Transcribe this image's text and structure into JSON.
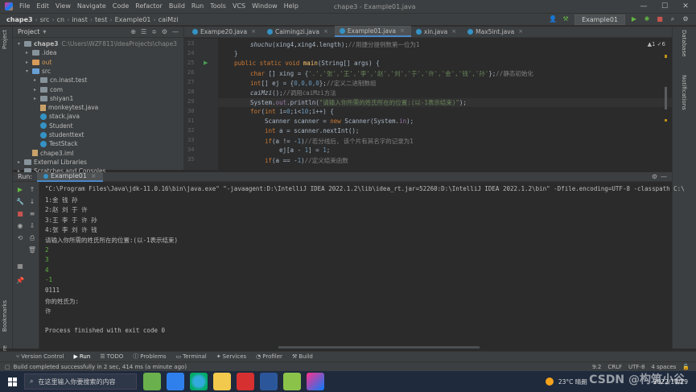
{
  "title_bar": {
    "menus": [
      "File",
      "Edit",
      "View",
      "Navigate",
      "Code",
      "Refactor",
      "Build",
      "Run",
      "Tools",
      "VCS",
      "Window",
      "Help"
    ],
    "window_title": "chape3 - Example01.java",
    "controls": [
      "—",
      "☐",
      "✕"
    ]
  },
  "nav_bar": {
    "crumbs": [
      "chape3",
      "src",
      "cn",
      "inast",
      "test",
      "Example01",
      "caiMzi"
    ],
    "run_config": "Example01"
  },
  "project_panel": {
    "title": "Project",
    "rows": [
      {
        "label": "chape3",
        "extra": "C:\\Users\\WZF811\\IdeaProjects\\chape3",
        "level": 0,
        "icon": "folder",
        "open": true
      },
      {
        "label": ".idea",
        "level": 1,
        "icon": "folder",
        "open": false
      },
      {
        "label": "out",
        "level": 1,
        "icon": "folder-orange",
        "open": false
      },
      {
        "label": "src",
        "level": 1,
        "icon": "folder-blue",
        "open": true
      },
      {
        "label": "cn.inast.test",
        "level": 2,
        "icon": "package",
        "open": false
      },
      {
        "label": "com",
        "level": 2,
        "icon": "package",
        "open": false
      },
      {
        "label": "shiyan1",
        "level": 2,
        "icon": "package",
        "open": false
      },
      {
        "label": "monkeytest.java",
        "level": 2,
        "icon": "file"
      },
      {
        "label": "stack.java",
        "level": 2,
        "icon": "class"
      },
      {
        "label": "Student",
        "level": 2,
        "icon": "class"
      },
      {
        "label": "studenttext",
        "level": 2,
        "icon": "class"
      },
      {
        "label": "TestStack",
        "level": 2,
        "icon": "class"
      },
      {
        "label": "chape3.iml",
        "level": 1,
        "icon": "file"
      },
      {
        "label": "External Libraries",
        "level": 0,
        "icon": "folder",
        "open": false
      },
      {
        "label": "Scratches and Consoles",
        "level": 0,
        "icon": "folder",
        "open": false
      }
    ]
  },
  "editor": {
    "tabs": [
      {
        "label": "Exampe20.java",
        "active": false
      },
      {
        "label": "Caimingzi.java",
        "active": false
      },
      {
        "label": "Example01.java",
        "active": true
      },
      {
        "label": "xin.java",
        "active": false
      },
      {
        "label": "Max5int.java",
        "active": false
      }
    ],
    "inspection": "▲1 ✓6",
    "line_numbers": [
      "23",
      "24",
      "25",
      "26",
      "27",
      "28",
      "29",
      "30",
      "31",
      "32",
      "33",
      "34",
      "35"
    ],
    "code": {
      "l23a": "shuchu",
      "l23b": "(xing4,xing4.length);",
      "l23c": "//用捷分提例数第一位为1",
      "l24": "}",
      "l25a": "public static void ",
      "l25b": "main",
      "l25c": "(String[] args) {",
      "l26a": "char",
      "l26b": " [] xing = {",
      "l26c": "'.','张','王','李','赵','刘','于','许','金','钱','孙'",
      "l26d": "};",
      "l26e": "//静态初始化",
      "l27a": "int",
      "l27b": "[] ej = {",
      "l27c": "0,0,0,0",
      "l27d": "};",
      "l27e": "//定义二进制数组",
      "l28a": "caiMzi",
      "l28b": "();",
      "l28c": "//调用caiMzi方法",
      "l29a": "System.",
      "l29b": "out",
      "l29c": ".println(",
      "l29d": "\"请输入你所需的姓氏所在的位置:(以-1表示结束)\"",
      "l29e": ");",
      "l30a": "for",
      "l30b": "(",
      "l30c": "int",
      "l30d": " i=",
      "l30e": "0",
      "l30f": ";i<",
      "l30g": "10",
      "l30h": ";i++) {",
      "l31a": "Scanner scanner = ",
      "l31b": "new",
      "l31c": " Scanner(System.",
      "l31d": "in",
      "l31e": ");",
      "l32a": "int",
      "l32b": " a = scanner.nextInt();",
      "l33a": "if",
      "l33b": "(a != -",
      "l33c": "1",
      "l33d": ")",
      "l33e": "//若分线后, 该个片有其名字的记录为1",
      "l34a": "ej[a - ",
      "l34b": "1",
      "l34c": "] = ",
      "l34d": "1",
      "l34e": ";",
      "l35a": "if",
      "l35b": "(a == -",
      "l35c": "1",
      "l35d": ")",
      "l35e": "//定义结束函数"
    }
  },
  "run_panel": {
    "label": "Run:",
    "tab": "Example01",
    "lines": [
      {
        "text": "\"C:\\Program Files\\Java\\jdk-11.0.16\\bin\\java.exe\" \"-javaagent:D:\\IntelliJ IDEA 2022.1.2\\lib\\idea_rt.jar=52260:D:\\IntelliJ IDEA 2022.1.2\\bin\" -Dfile.encoding=UTF-8 -classpath C:\\",
        "input": false
      },
      {
        "text": "1:金 钱 孙",
        "input": false
      },
      {
        "text": "2:赵 刘 于 许",
        "input": false
      },
      {
        "text": "3:王 李 于 许 孙",
        "input": false
      },
      {
        "text": "4:张 李 刘 许 钱",
        "input": false
      },
      {
        "text": "请输入你所需的姓氏所在的位置:(以-1表示结束)",
        "input": false
      },
      {
        "text": "2",
        "input": true
      },
      {
        "text": "3",
        "input": true
      },
      {
        "text": "4",
        "input": true
      },
      {
        "text": "-1",
        "input": true
      },
      {
        "text": "0111",
        "input": false
      },
      {
        "text": "你的姓氏为:",
        "input": false
      },
      {
        "text": "许",
        "input": false
      },
      {
        "text": "",
        "input": false
      },
      {
        "text": "Process finished with exit code 0",
        "input": false
      }
    ]
  },
  "bottom_tools": [
    "Version Control",
    "Run",
    "TODO",
    "Problems",
    "Terminal",
    "Services",
    "Profiler",
    "Build"
  ],
  "status_bar": {
    "message": "Build completed successfully in 2 sec, 414 ms (a minute ago)",
    "position": "9:2",
    "line_sep": "CRLF",
    "encoding": "UTF-8",
    "indent": "4 spaces"
  },
  "taskbar": {
    "search_placeholder": "在这里输入你要搜索的内容",
    "weather": "23°C 晴朗",
    "date": "2022/10/29",
    "watermark": "CSDN @构筑小谷"
  },
  "colors": {
    "accent": "#4a88c7",
    "keyword": "#cc7832",
    "string": "#6a8759",
    "input_green": "#62b543"
  }
}
